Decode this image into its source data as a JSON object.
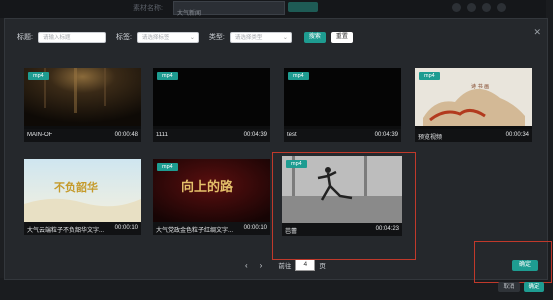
{
  "background": {
    "label": "素材名称:",
    "input_value": "大气新闻"
  },
  "filters": {
    "title_label": "标题:",
    "title_placeholder": "请输入标题",
    "tag_label": "标签:",
    "tag_placeholder": "请选择标签",
    "type_label": "类型:",
    "type_placeholder": "请选择类型",
    "search_label": "搜索",
    "reset_label": "重置"
  },
  "videos": [
    {
      "tag": "mp4",
      "name": "MAIN-OF",
      "duration": "00:00:48"
    },
    {
      "tag": "mp4",
      "name": "1111",
      "duration": "00:04:39"
    },
    {
      "tag": "mp4",
      "name": "test",
      "duration": "00:04:39"
    },
    {
      "tag": "mp4",
      "name": "预览视频",
      "duration": "00:00:34"
    },
    {
      "tag": "mp4",
      "name": "大气云端粒子不负韶华文字...",
      "duration": "00:00:10"
    },
    {
      "tag": "mp4",
      "name": "大气党政金色粒子红绸文字...",
      "duration": "00:00:10"
    },
    {
      "tag": "mp4",
      "name": "芭蕾",
      "duration": "00:04:23"
    }
  ],
  "pagination": {
    "prev": "‹",
    "next": "›",
    "goto_label": "前往",
    "page": "4",
    "page_suffix": "页"
  },
  "actions": {
    "confirm": "确定",
    "cancel": "取消",
    "confirm_bg": "确定"
  },
  "colors": {
    "accent": "#1e9c91",
    "highlight": "#c0392b"
  }
}
